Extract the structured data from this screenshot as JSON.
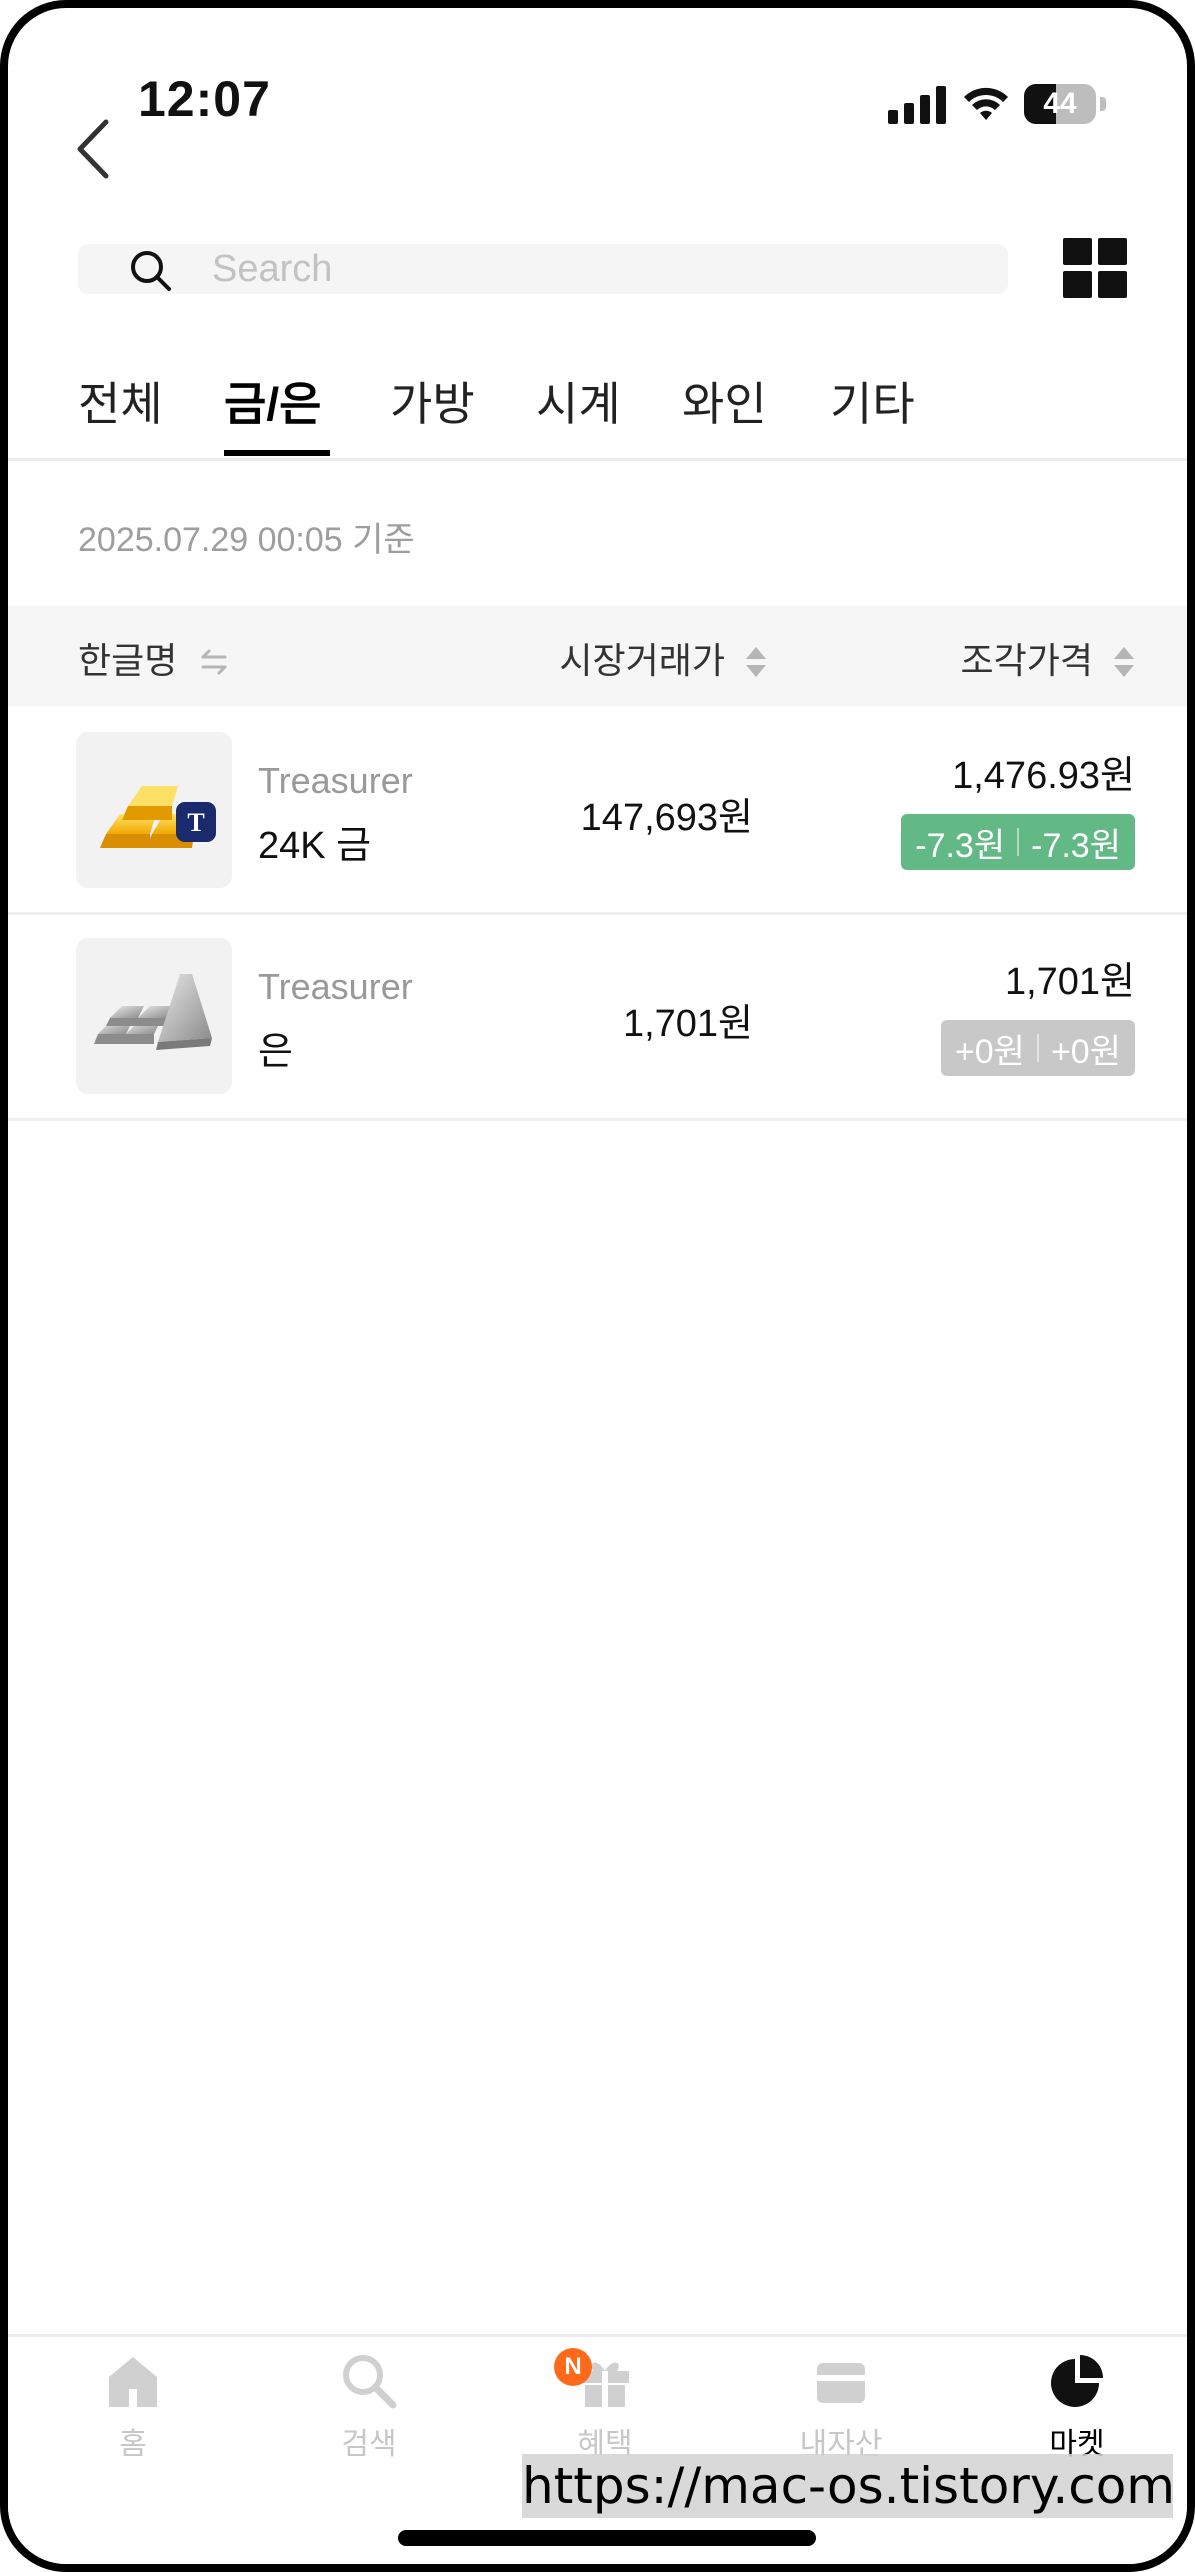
{
  "status_bar": {
    "time": "12:07",
    "battery": 44
  },
  "search": {
    "placeholder": "Search",
    "value": ""
  },
  "tabs": [
    {
      "label": "전체",
      "active": false
    },
    {
      "label": "금/은",
      "active": true
    },
    {
      "label": "가방",
      "active": false
    },
    {
      "label": "시계",
      "active": false
    },
    {
      "label": "와인",
      "active": false
    },
    {
      "label": "기타",
      "active": false
    }
  ],
  "timestamp": "2025.07.29 00:05 기준",
  "table_header": {
    "name": "한글명",
    "market_price": "시장거래가",
    "piece_price": "조각가격"
  },
  "rows": [
    {
      "brand": "Treasurer",
      "name": "24K 금",
      "market_price": "147,693원",
      "piece_price": "1,476.93원",
      "change_a": "-7.3원",
      "change_b": "-7.3원",
      "change_color": "#63b985",
      "icon": "gold-bars-icon"
    },
    {
      "brand": "Treasurer",
      "name": "은",
      "market_price": "1,701원",
      "piece_price": "1,701원",
      "change_a": "+0원",
      "change_b": "+0원",
      "change_color": "#c8c8c8",
      "icon": "silver-bars-icon"
    }
  ],
  "bottom_nav": [
    {
      "label": "홈",
      "icon": "home-icon",
      "active": false
    },
    {
      "label": "검색",
      "icon": "search-icon",
      "active": false
    },
    {
      "label": "혜택",
      "icon": "gift-icon",
      "active": false,
      "badge": "N"
    },
    {
      "label": "내자산",
      "icon": "wallet-icon",
      "active": false
    },
    {
      "label": "마켓",
      "icon": "pie-chart-icon",
      "active": true
    }
  ],
  "watermark": "https://mac-os.tistory.com"
}
